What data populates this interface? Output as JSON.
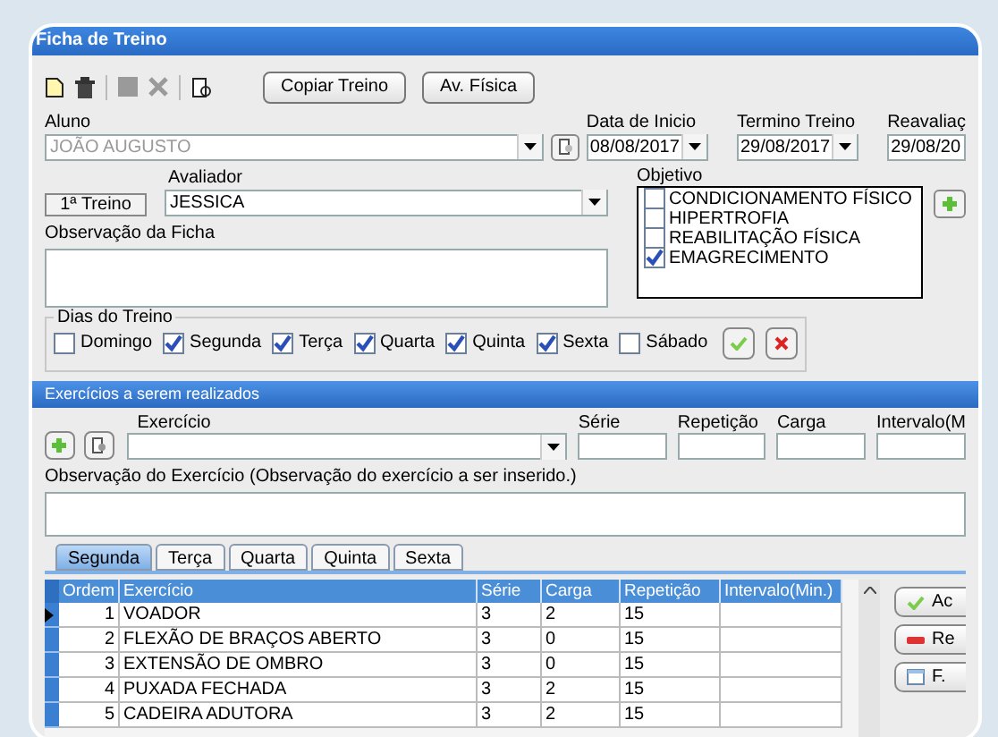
{
  "window": {
    "title": "Ficha de Treino"
  },
  "toolbar": {
    "buttons": [
      "Copiar Treino",
      "Av. Física"
    ]
  },
  "aluno": {
    "label": "Aluno",
    "value": "JOÃO AUGUSTO",
    "disabled": true
  },
  "dates": [
    {
      "label": "Data de Inicio",
      "value": "08/08/2017",
      "dropdown": true
    },
    {
      "label": "Termino Treino",
      "value": "29/08/2017",
      "dropdown": true
    },
    {
      "label": "Reavaliaç",
      "value": "29/08/20",
      "dropdown": false
    }
  ],
  "treino_number": "1ª Treino",
  "avaliador": {
    "label": "Avaliador",
    "value": "JESSICA"
  },
  "objetivo": {
    "label": "Objetivo",
    "items": [
      {
        "label": "CONDICIONAMENTO FÍSICO",
        "checked": false
      },
      {
        "label": "HIPERTROFIA",
        "checked": false
      },
      {
        "label": "REABILITAÇÃO FÍSICA",
        "checked": false
      },
      {
        "label": "EMAGRECIMENTO",
        "checked": true
      }
    ]
  },
  "observacao_ficha": {
    "label": "Observação da Ficha"
  },
  "dias": {
    "label": "Dias do Treino",
    "items": [
      {
        "label": "Domingo",
        "checked": false
      },
      {
        "label": "Segunda",
        "checked": true
      },
      {
        "label": "Terça",
        "checked": true
      },
      {
        "label": "Quarta",
        "checked": true
      },
      {
        "label": "Quinta",
        "checked": true
      },
      {
        "label": "Sexta",
        "checked": true
      },
      {
        "label": "Sábado",
        "checked": false
      }
    ]
  },
  "exercicios": {
    "title": "Exercícios a serem realizados",
    "exercicio_label": "Exercício",
    "fields": [
      {
        "label": "Série"
      },
      {
        "label": "Repetição"
      },
      {
        "label": "Carga"
      },
      {
        "label": "Intervalo(M"
      }
    ],
    "observacao_label": "Observação do Exercício (Observação do exercício a ser inserido.)"
  },
  "tabs": [
    {
      "label": "Segunda",
      "selected": true
    },
    {
      "label": "Terça",
      "selected": false
    },
    {
      "label": "Quarta",
      "selected": false
    },
    {
      "label": "Quinta",
      "selected": false
    },
    {
      "label": "Sexta",
      "selected": false
    }
  ],
  "table": {
    "columns": [
      "Ordem",
      "Exercício",
      "Série",
      "Carga",
      "Repetição",
      "Intervalo(Min.)"
    ],
    "rows": [
      {
        "cells": [
          "1",
          "VOADOR",
          "3",
          "2",
          "15",
          ""
        ],
        "selected": true
      },
      {
        "cells": [
          "2",
          "FLEXÃO DE BRAÇOS ABERTO",
          "3",
          "0",
          "15",
          ""
        ],
        "selected": false
      },
      {
        "cells": [
          "3",
          "EXTENSÃO DE OMBRO",
          "3",
          "0",
          "15",
          ""
        ],
        "selected": false
      },
      {
        "cells": [
          "4",
          "PUXADA FECHADA",
          "3",
          "2",
          "15",
          ""
        ],
        "selected": false
      },
      {
        "cells": [
          "5",
          "CADEIRA ADUTORA",
          "3",
          "2",
          "15",
          ""
        ],
        "selected": false
      }
    ]
  },
  "side_buttons": [
    {
      "label": "Ac",
      "kind": "add"
    },
    {
      "label": "Re",
      "kind": "remove"
    },
    {
      "label": "F.",
      "kind": "form"
    }
  ]
}
